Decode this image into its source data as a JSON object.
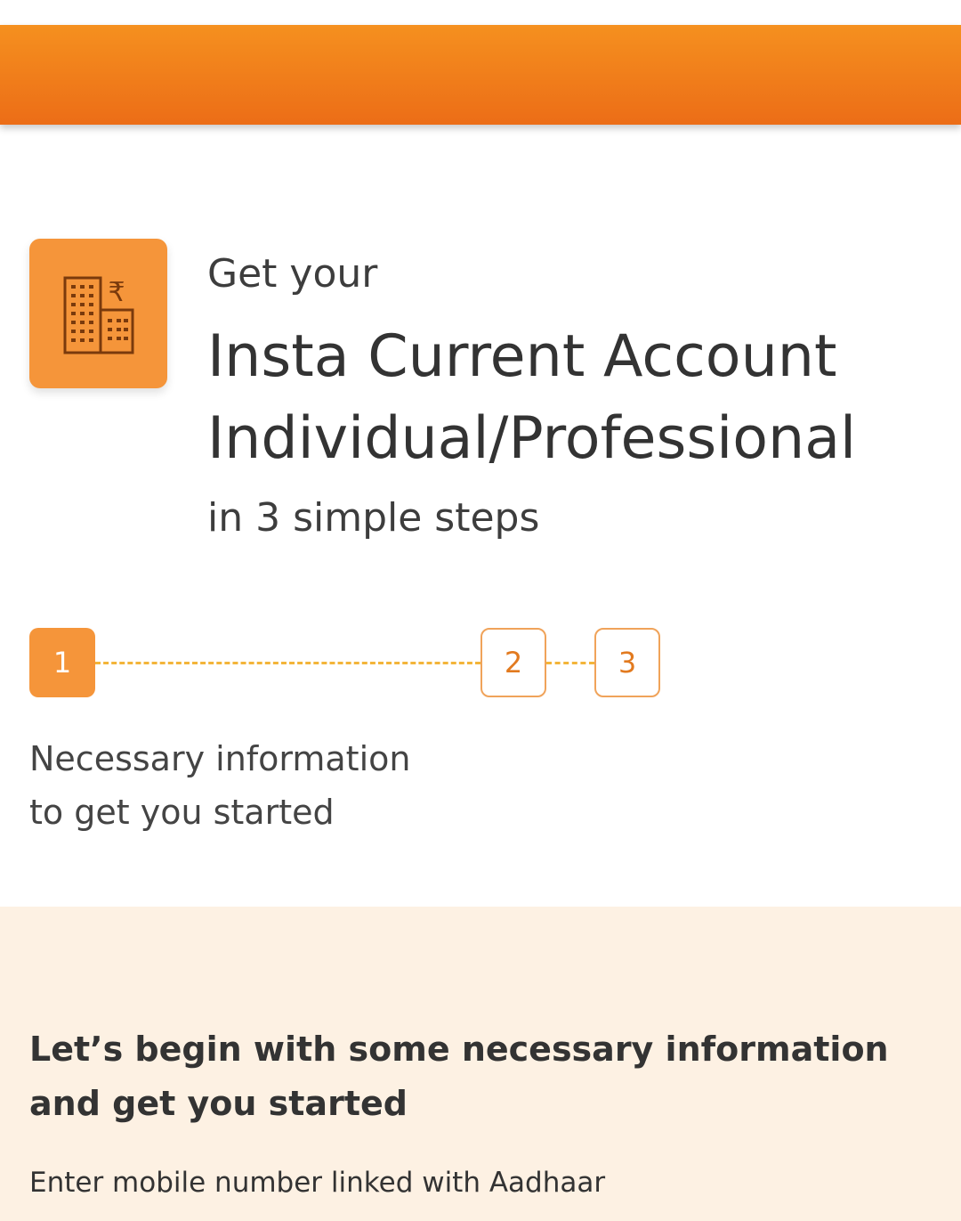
{
  "header": {
    "brand_color": "#ec6d17"
  },
  "hero": {
    "icon": "building-rupee-icon",
    "intro": "Get your",
    "title_line1": "Insta Current Account",
    "title_line2": "Individual/Professional",
    "outro": "in 3 simple steps"
  },
  "stepper": {
    "steps": [
      {
        "number": "1",
        "state": "active"
      },
      {
        "number": "2",
        "state": "pending"
      },
      {
        "number": "3",
        "state": "pending"
      }
    ],
    "current_description_line1": "Necessary information",
    "current_description_line2": "to get you started"
  },
  "form": {
    "heading_line1": "Let’s begin with some necessary information",
    "heading_line2": "and get you started",
    "mobile_label": "Enter mobile number linked with Aadhaar"
  }
}
